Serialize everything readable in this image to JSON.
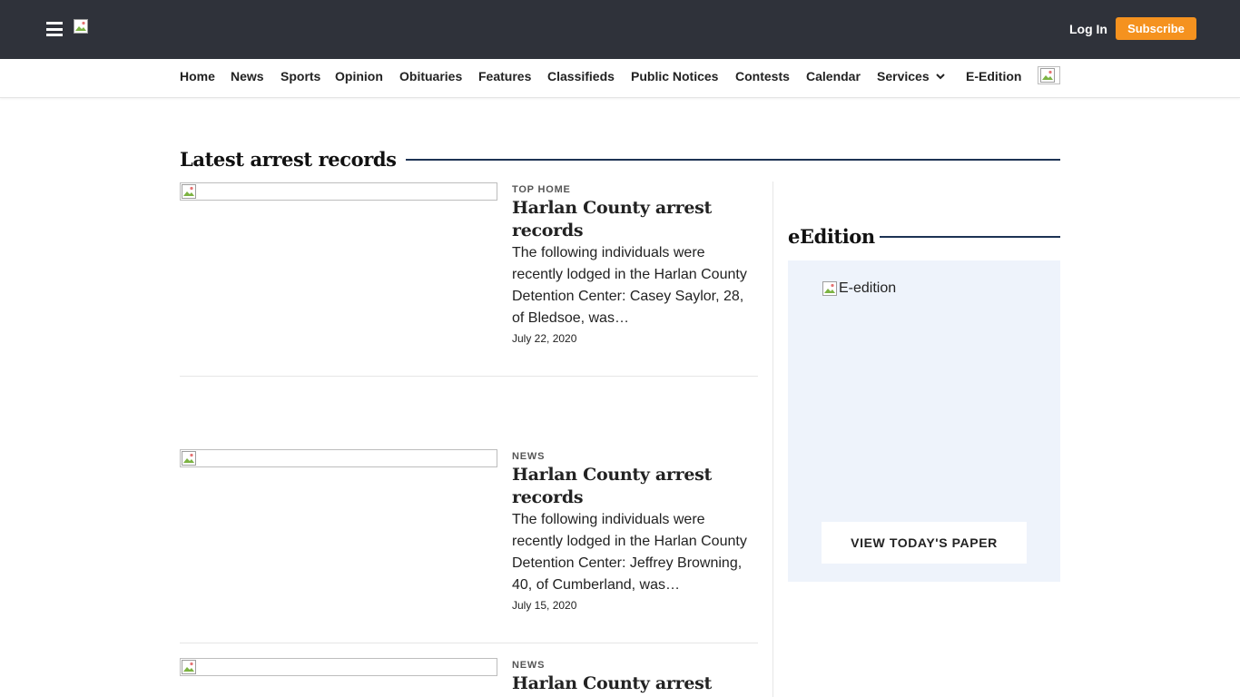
{
  "header": {
    "login_label": "Log In",
    "subscribe_label": "Subscribe",
    "logo_icon": "broken-image-icon",
    "menu_icon": "hamburger-menu-icon",
    "colors": {
      "bar": "#2f323a",
      "subscribe": "#f5921f"
    }
  },
  "nav": {
    "items": [
      "Home",
      "News",
      "Sports",
      "Opinion",
      "Obituaries",
      "Features",
      "Classifieds",
      "Public Notices",
      "Contests",
      "Calendar",
      "Services",
      "E-Edition"
    ],
    "services_icon": "chevron-down-icon",
    "image_icon": "broken-image-icon"
  },
  "main": {
    "section_title": "Latest arrest records",
    "articles": [
      {
        "kicker": "TOP HOME",
        "headline": "Harlan County arrest records",
        "summary": "The following individuals were recently lodged in the Harlan County Detention Center: Casey Saylor, 28, of Bledsoe, was…",
        "date": "July 22, 2020"
      },
      {
        "kicker": "NEWS",
        "headline": "Harlan County arrest records",
        "summary": "The following individuals were recently lodged in the Harlan County Detention Center: Jeffrey Browning, 40, of Cumberland, was…",
        "date": "July 15, 2020"
      },
      {
        "kicker": "NEWS",
        "headline": "Harlan County arrest records",
        "summary": "",
        "date": ""
      }
    ]
  },
  "sidebar": {
    "title": "eEdition",
    "image_alt": "E-edition",
    "button_label": "VIEW TODAY'S PAPER",
    "colors": {
      "box": "#eef3fb",
      "rule": "#1d3354"
    }
  }
}
